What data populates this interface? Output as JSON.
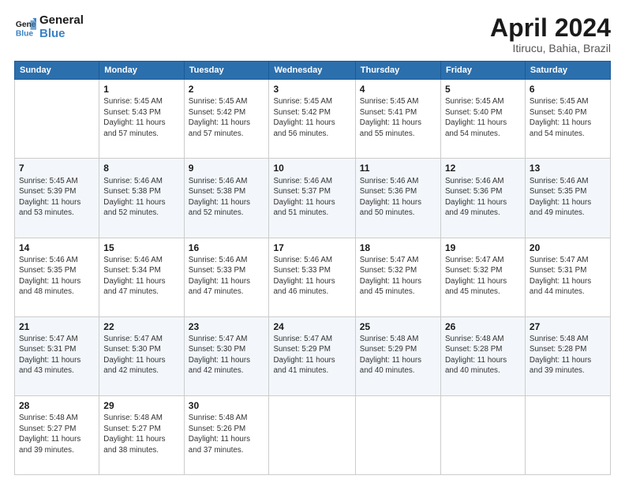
{
  "header": {
    "logo_line1": "General",
    "logo_line2": "Blue",
    "month": "April 2024",
    "location": "Itirucu, Bahia, Brazil"
  },
  "weekdays": [
    "Sunday",
    "Monday",
    "Tuesday",
    "Wednesday",
    "Thursday",
    "Friday",
    "Saturday"
  ],
  "weeks": [
    [
      {
        "day": "",
        "info": ""
      },
      {
        "day": "1",
        "info": "Sunrise: 5:45 AM\nSunset: 5:43 PM\nDaylight: 11 hours\nand 57 minutes."
      },
      {
        "day": "2",
        "info": "Sunrise: 5:45 AM\nSunset: 5:42 PM\nDaylight: 11 hours\nand 57 minutes."
      },
      {
        "day": "3",
        "info": "Sunrise: 5:45 AM\nSunset: 5:42 PM\nDaylight: 11 hours\nand 56 minutes."
      },
      {
        "day": "4",
        "info": "Sunrise: 5:45 AM\nSunset: 5:41 PM\nDaylight: 11 hours\nand 55 minutes."
      },
      {
        "day": "5",
        "info": "Sunrise: 5:45 AM\nSunset: 5:40 PM\nDaylight: 11 hours\nand 54 minutes."
      },
      {
        "day": "6",
        "info": "Sunrise: 5:45 AM\nSunset: 5:40 PM\nDaylight: 11 hours\nand 54 minutes."
      }
    ],
    [
      {
        "day": "7",
        "info": "Sunrise: 5:45 AM\nSunset: 5:39 PM\nDaylight: 11 hours\nand 53 minutes."
      },
      {
        "day": "8",
        "info": "Sunrise: 5:46 AM\nSunset: 5:38 PM\nDaylight: 11 hours\nand 52 minutes."
      },
      {
        "day": "9",
        "info": "Sunrise: 5:46 AM\nSunset: 5:38 PM\nDaylight: 11 hours\nand 52 minutes."
      },
      {
        "day": "10",
        "info": "Sunrise: 5:46 AM\nSunset: 5:37 PM\nDaylight: 11 hours\nand 51 minutes."
      },
      {
        "day": "11",
        "info": "Sunrise: 5:46 AM\nSunset: 5:36 PM\nDaylight: 11 hours\nand 50 minutes."
      },
      {
        "day": "12",
        "info": "Sunrise: 5:46 AM\nSunset: 5:36 PM\nDaylight: 11 hours\nand 49 minutes."
      },
      {
        "day": "13",
        "info": "Sunrise: 5:46 AM\nSunset: 5:35 PM\nDaylight: 11 hours\nand 49 minutes."
      }
    ],
    [
      {
        "day": "14",
        "info": "Sunrise: 5:46 AM\nSunset: 5:35 PM\nDaylight: 11 hours\nand 48 minutes."
      },
      {
        "day": "15",
        "info": "Sunrise: 5:46 AM\nSunset: 5:34 PM\nDaylight: 11 hours\nand 47 minutes."
      },
      {
        "day": "16",
        "info": "Sunrise: 5:46 AM\nSunset: 5:33 PM\nDaylight: 11 hours\nand 47 minutes."
      },
      {
        "day": "17",
        "info": "Sunrise: 5:46 AM\nSunset: 5:33 PM\nDaylight: 11 hours\nand 46 minutes."
      },
      {
        "day": "18",
        "info": "Sunrise: 5:47 AM\nSunset: 5:32 PM\nDaylight: 11 hours\nand 45 minutes."
      },
      {
        "day": "19",
        "info": "Sunrise: 5:47 AM\nSunset: 5:32 PM\nDaylight: 11 hours\nand 45 minutes."
      },
      {
        "day": "20",
        "info": "Sunrise: 5:47 AM\nSunset: 5:31 PM\nDaylight: 11 hours\nand 44 minutes."
      }
    ],
    [
      {
        "day": "21",
        "info": "Sunrise: 5:47 AM\nSunset: 5:31 PM\nDaylight: 11 hours\nand 43 minutes."
      },
      {
        "day": "22",
        "info": "Sunrise: 5:47 AM\nSunset: 5:30 PM\nDaylight: 11 hours\nand 42 minutes."
      },
      {
        "day": "23",
        "info": "Sunrise: 5:47 AM\nSunset: 5:30 PM\nDaylight: 11 hours\nand 42 minutes."
      },
      {
        "day": "24",
        "info": "Sunrise: 5:47 AM\nSunset: 5:29 PM\nDaylight: 11 hours\nand 41 minutes."
      },
      {
        "day": "25",
        "info": "Sunrise: 5:48 AM\nSunset: 5:29 PM\nDaylight: 11 hours\nand 40 minutes."
      },
      {
        "day": "26",
        "info": "Sunrise: 5:48 AM\nSunset: 5:28 PM\nDaylight: 11 hours\nand 40 minutes."
      },
      {
        "day": "27",
        "info": "Sunrise: 5:48 AM\nSunset: 5:28 PM\nDaylight: 11 hours\nand 39 minutes."
      }
    ],
    [
      {
        "day": "28",
        "info": "Sunrise: 5:48 AM\nSunset: 5:27 PM\nDaylight: 11 hours\nand 39 minutes."
      },
      {
        "day": "29",
        "info": "Sunrise: 5:48 AM\nSunset: 5:27 PM\nDaylight: 11 hours\nand 38 minutes."
      },
      {
        "day": "30",
        "info": "Sunrise: 5:48 AM\nSunset: 5:26 PM\nDaylight: 11 hours\nand 37 minutes."
      },
      {
        "day": "",
        "info": ""
      },
      {
        "day": "",
        "info": ""
      },
      {
        "day": "",
        "info": ""
      },
      {
        "day": "",
        "info": ""
      }
    ]
  ]
}
